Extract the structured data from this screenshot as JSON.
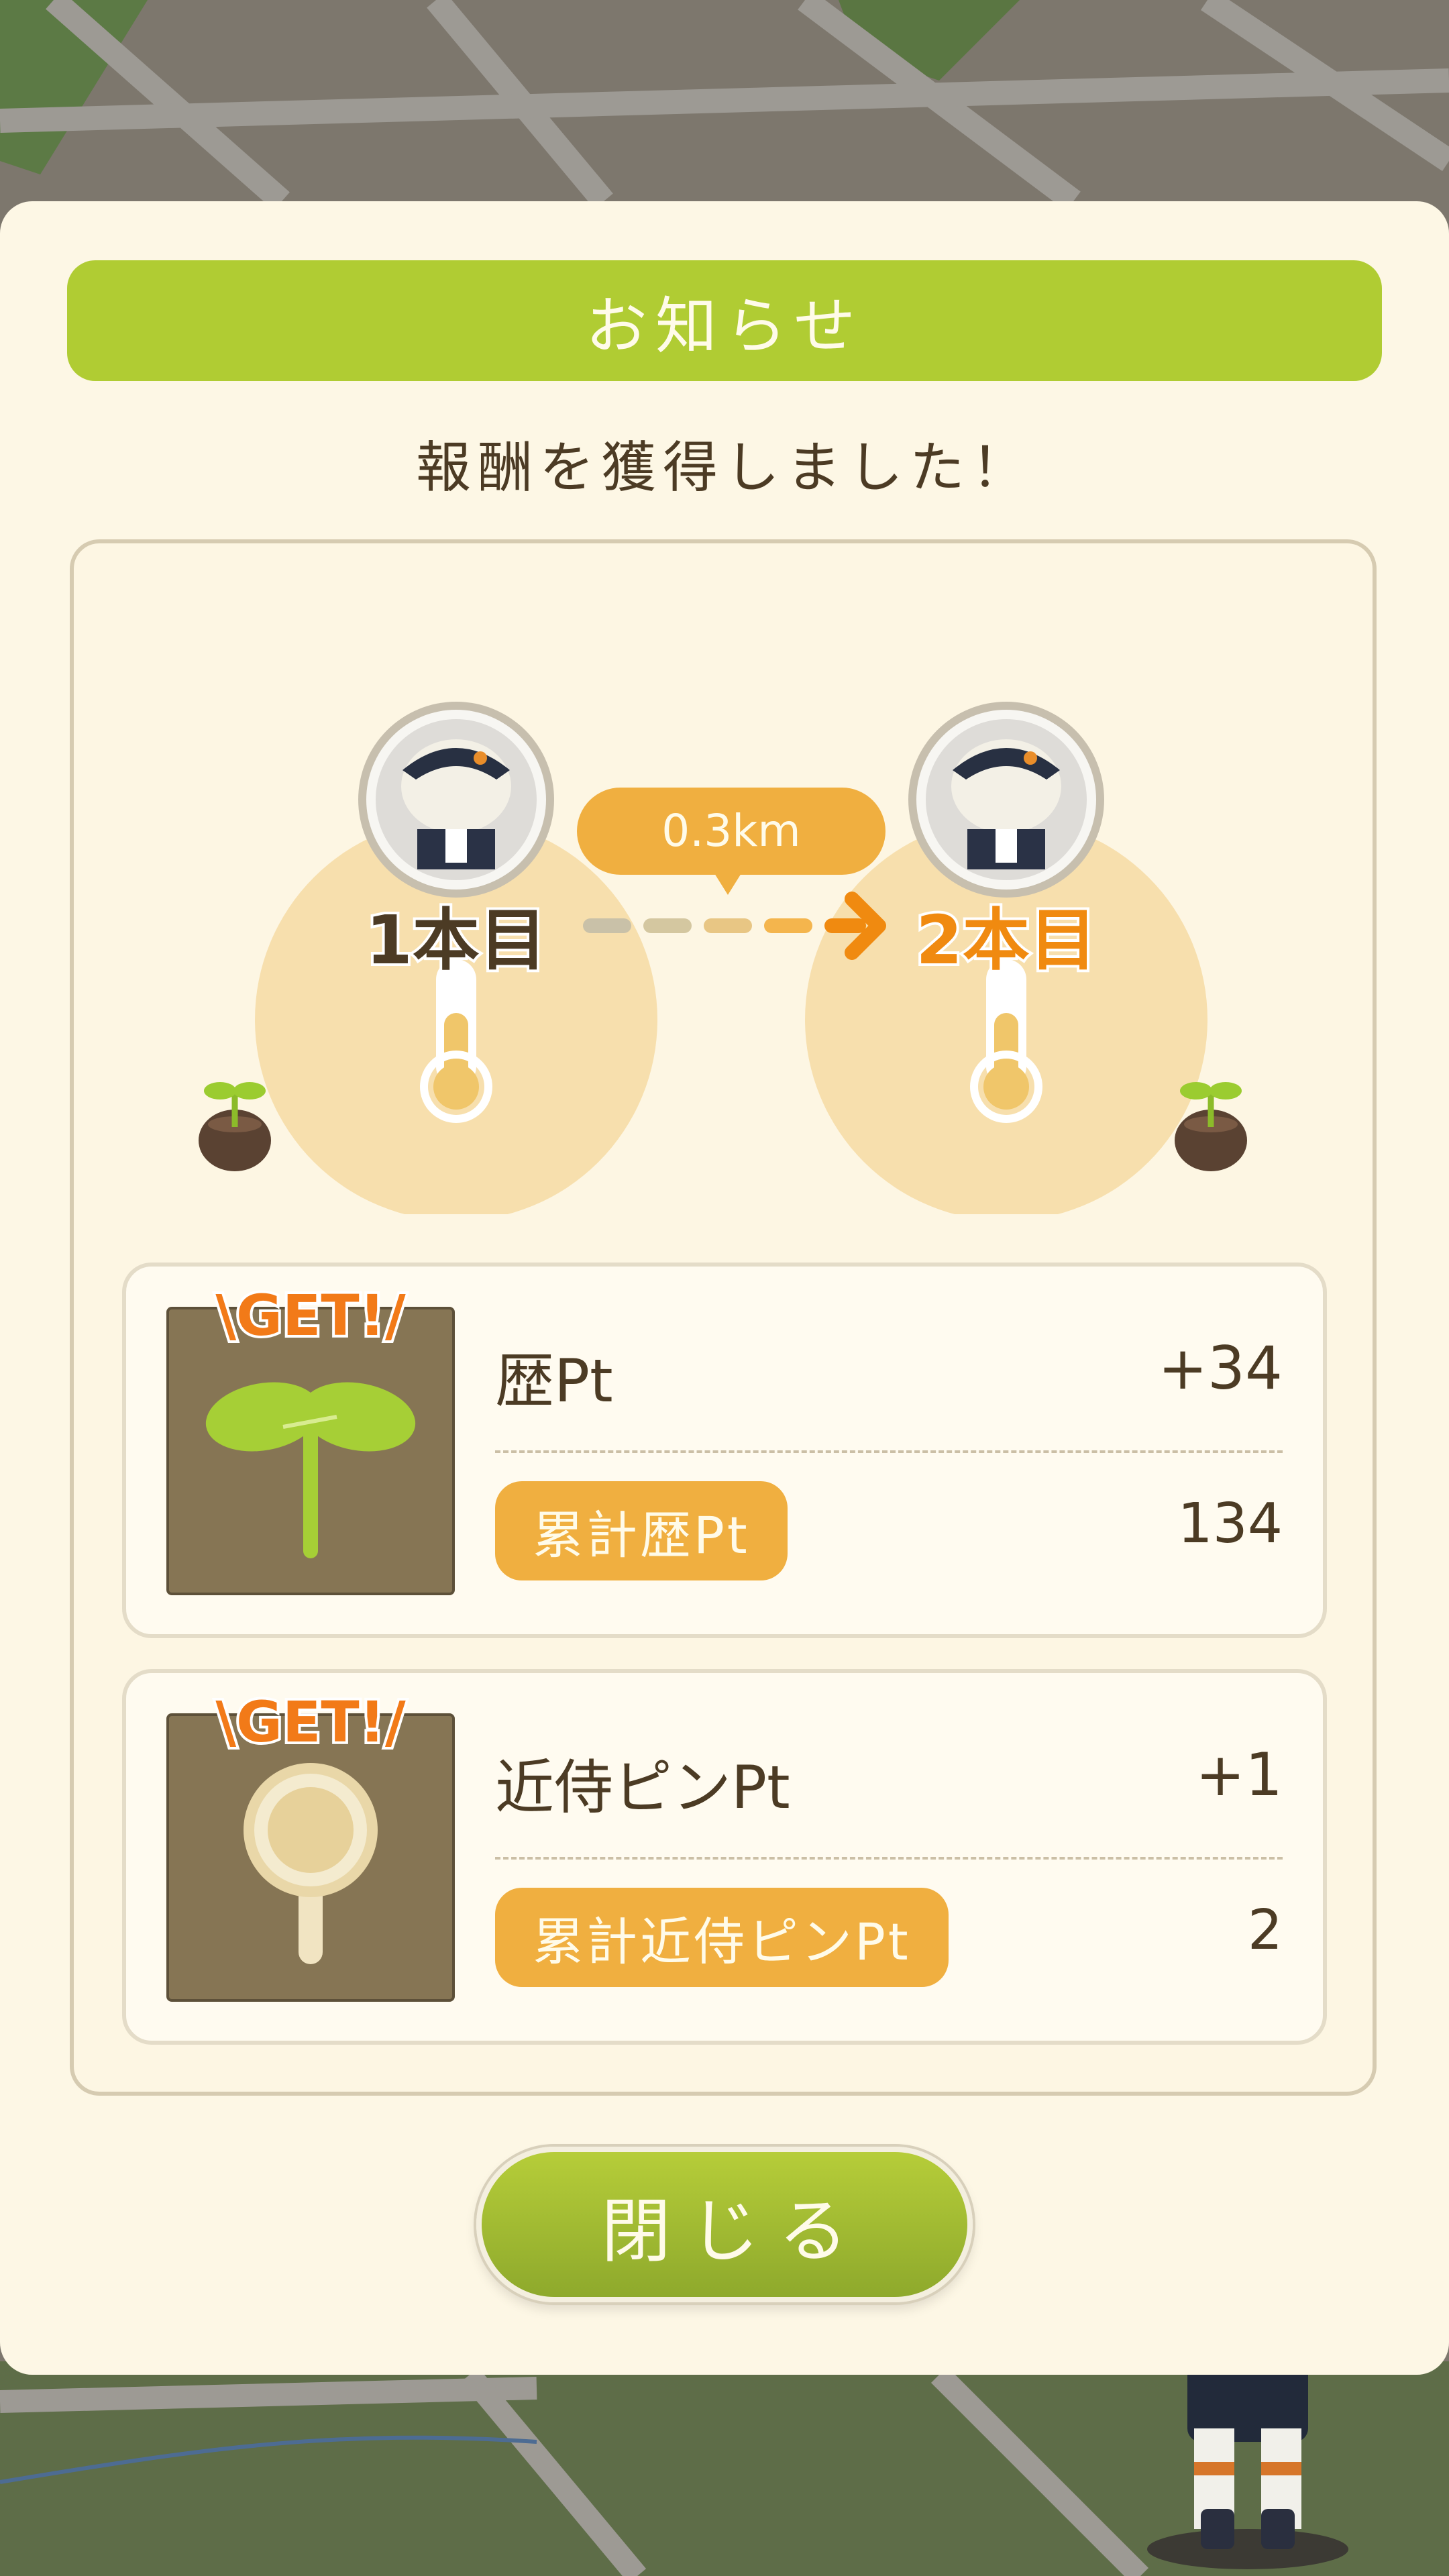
{
  "dialog": {
    "title": "お知らせ",
    "message": "報酬を獲得しました！"
  },
  "progress": {
    "from_label": "1本目",
    "to_label": "2本目",
    "distance": "0.3km"
  },
  "rewards": [
    {
      "badge": "\\GET!/",
      "label": "歴Pt",
      "value": "+34",
      "total_label": "累計歴Pt",
      "total_value": "134",
      "icon": "sprout-icon"
    },
    {
      "badge": "\\GET!/",
      "label": "近侍ピンPt",
      "value": "+1",
      "total_label": "累計近侍ピンPt",
      "total_value": "2",
      "icon": "pin-icon"
    }
  ],
  "close_button": "閉じる",
  "colors": {
    "accent_green": "#b0cc33",
    "accent_orange": "#f0af40",
    "highlight_orange": "#f08a10",
    "text_brown": "#4c3b24",
    "dialog_bg": "#fdf7e5"
  }
}
